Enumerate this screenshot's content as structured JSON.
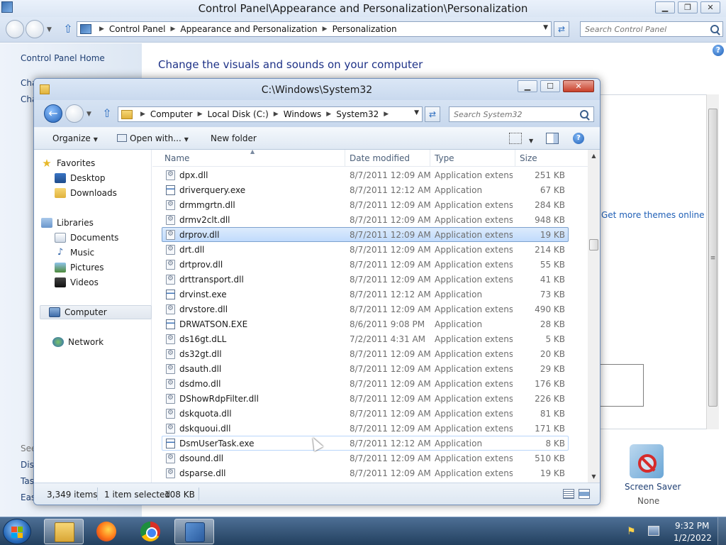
{
  "cp": {
    "title": "Control Panel\\Appearance and Personalization\\Personalization",
    "breadcrumbs": [
      "Control Panel",
      "Appearance and Personalization",
      "Personalization"
    ],
    "search_placeholder": "Search Control Panel",
    "home_link": "Control Panel Home",
    "side_partial_1": "Cha",
    "side_partial_2": "Cha",
    "see_also": "See",
    "side_bottom": [
      "Disp",
      "Task",
      "Eas"
    ],
    "main_title": "Change the visuals and sounds on your computer",
    "more_themes": "Get more themes online",
    "screen_saver_label": "Screen Saver",
    "screen_saver_value": "None"
  },
  "explorer": {
    "title": "C:\\Windows\\System32",
    "breadcrumbs": [
      "Computer",
      "Local Disk (C:)",
      "Windows",
      "System32"
    ],
    "search_placeholder": "Search System32",
    "toolbar": {
      "organize": "Organize",
      "open_with": "Open with...",
      "new_folder": "New folder"
    },
    "nav": {
      "favorites": "Favorites",
      "desktop": "Desktop",
      "downloads": "Downloads",
      "libraries": "Libraries",
      "documents": "Documents",
      "music": "Music",
      "pictures": "Pictures",
      "videos": "Videos",
      "computer": "Computer",
      "network": "Network"
    },
    "columns": {
      "name": "Name",
      "date": "Date modified",
      "type": "Type",
      "size": "Size"
    },
    "files": [
      {
        "name": "dpx.dll",
        "date": "8/7/2011 12:09 AM",
        "type": "Application extens...",
        "size": "251 KB",
        "kind": "dll"
      },
      {
        "name": "driverquery.exe",
        "date": "8/7/2011 12:12 AM",
        "type": "Application",
        "size": "67 KB",
        "kind": "exe"
      },
      {
        "name": "drmmgrtn.dll",
        "date": "8/7/2011 12:09 AM",
        "type": "Application extens...",
        "size": "284 KB",
        "kind": "dll"
      },
      {
        "name": "drmv2clt.dll",
        "date": "8/7/2011 12:09 AM",
        "type": "Application extens...",
        "size": "948 KB",
        "kind": "dll"
      },
      {
        "name": "drprov.dll",
        "date": "8/7/2011 12:09 AM",
        "type": "Application extens...",
        "size": "19 KB",
        "kind": "dll",
        "selected": true
      },
      {
        "name": "drt.dll",
        "date": "8/7/2011 12:09 AM",
        "type": "Application extens...",
        "size": "214 KB",
        "kind": "dll"
      },
      {
        "name": "drtprov.dll",
        "date": "8/7/2011 12:09 AM",
        "type": "Application extens...",
        "size": "55 KB",
        "kind": "dll"
      },
      {
        "name": "drttransport.dll",
        "date": "8/7/2011 12:09 AM",
        "type": "Application extens...",
        "size": "41 KB",
        "kind": "dll"
      },
      {
        "name": "drvinst.exe",
        "date": "8/7/2011 12:12 AM",
        "type": "Application",
        "size": "73 KB",
        "kind": "exe"
      },
      {
        "name": "drvstore.dll",
        "date": "8/7/2011 12:09 AM",
        "type": "Application extens...",
        "size": "490 KB",
        "kind": "dll"
      },
      {
        "name": "DRWATSON.EXE",
        "date": "8/6/2011 9:08 PM",
        "type": "Application",
        "size": "28 KB",
        "kind": "exe"
      },
      {
        "name": "ds16gt.dLL",
        "date": "7/2/2011 4:31 AM",
        "type": "Application extens...",
        "size": "5 KB",
        "kind": "dll"
      },
      {
        "name": "ds32gt.dll",
        "date": "8/7/2011 12:09 AM",
        "type": "Application extens...",
        "size": "20 KB",
        "kind": "dll"
      },
      {
        "name": "dsauth.dll",
        "date": "8/7/2011 12:09 AM",
        "type": "Application extens...",
        "size": "29 KB",
        "kind": "dll"
      },
      {
        "name": "dsdmo.dll",
        "date": "8/7/2011 12:09 AM",
        "type": "Application extens...",
        "size": "176 KB",
        "kind": "dll"
      },
      {
        "name": "DShowRdpFilter.dll",
        "date": "8/7/2011 12:09 AM",
        "type": "Application extens...",
        "size": "226 KB",
        "kind": "dll"
      },
      {
        "name": "dskquota.dll",
        "date": "8/7/2011 12:09 AM",
        "type": "Application extens...",
        "size": "81 KB",
        "kind": "dll"
      },
      {
        "name": "dskquoui.dll",
        "date": "8/7/2011 12:09 AM",
        "type": "Application extens...",
        "size": "171 KB",
        "kind": "dll"
      },
      {
        "name": "DsmUserTask.exe",
        "date": "8/7/2011 12:12 AM",
        "type": "Application",
        "size": "8 KB",
        "kind": "exe",
        "hover": true
      },
      {
        "name": "dsound.dll",
        "date": "8/7/2011 12:09 AM",
        "type": "Application extens...",
        "size": "510 KB",
        "kind": "dll"
      },
      {
        "name": "dsparse.dll",
        "date": "8/7/2011 12:09 AM",
        "type": "Application extens...",
        "size": "19 KB",
        "kind": "dll"
      }
    ],
    "status": {
      "count": "3,349 items",
      "selection": "1 item selected",
      "selection_size": "108 KB"
    }
  },
  "taskbar": {
    "time": "9:32 PM",
    "date": "1/2/2022"
  }
}
